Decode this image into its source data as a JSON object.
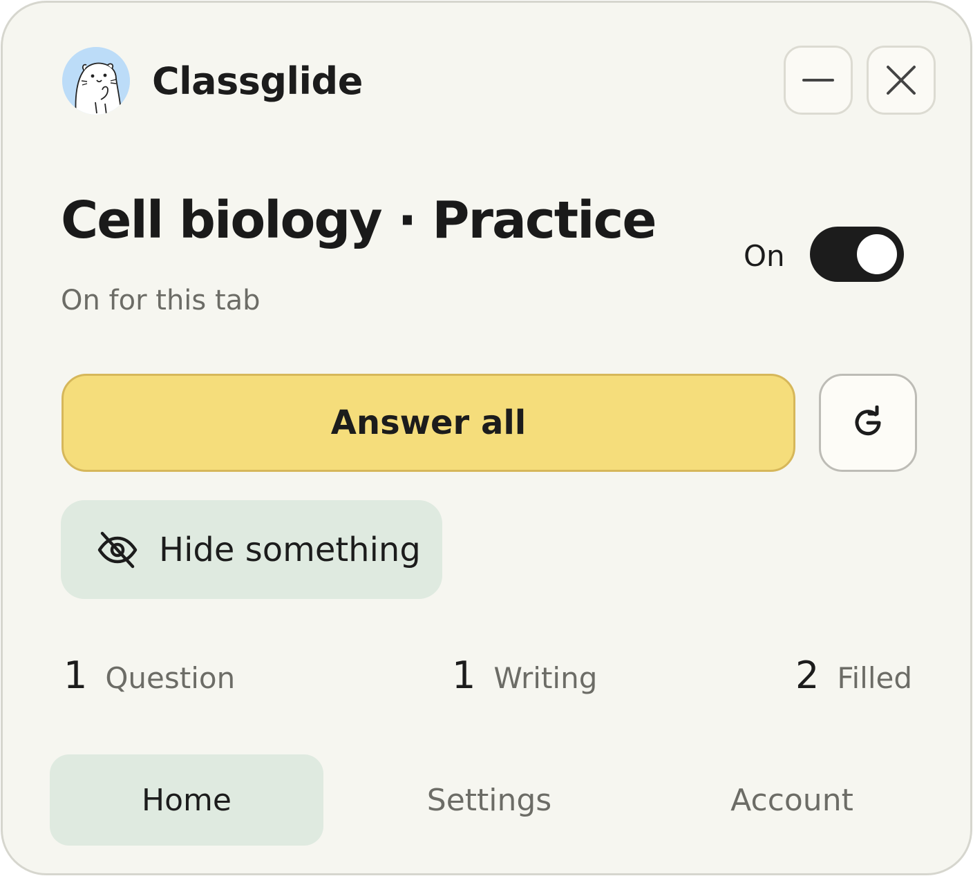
{
  "app": {
    "name": "Classglide"
  },
  "window_controls": {
    "minimize_icon": "minus-icon",
    "close_icon": "close-icon"
  },
  "main": {
    "title": "Cell biology · Practice",
    "subtitle": "On for this tab",
    "toggle": {
      "label": "On",
      "state": true
    }
  },
  "actions": {
    "answer_all": "Answer all",
    "refresh_icon": "refresh-icon",
    "hide_label": "Hide something",
    "hide_icon": "eye-off-icon"
  },
  "stats": [
    {
      "count": "1",
      "label": "Question"
    },
    {
      "count": "1",
      "label": "Writing"
    },
    {
      "count": "2",
      "label": "Filled"
    }
  ],
  "nav": {
    "tabs": [
      {
        "label": "Home",
        "active": true
      },
      {
        "label": "Settings",
        "active": false
      },
      {
        "label": "Account",
        "active": false
      }
    ]
  },
  "colors": {
    "primary_button": "#f5dd7b",
    "soft_green": "#dfeae0",
    "toggle_on": "#1c1c1c",
    "background": "#f6f6f0"
  }
}
